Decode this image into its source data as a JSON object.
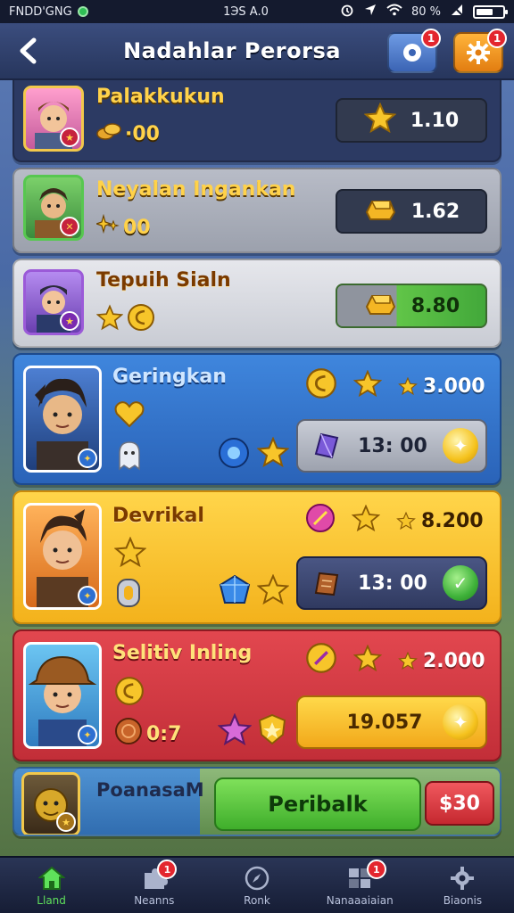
{
  "status_bar": {
    "carrier": "FNDD'GNG",
    "time": "1ЭS A.0",
    "battery_pct": "80 %"
  },
  "header": {
    "title": "Nadahlar Perorsa",
    "left_badge": "1",
    "right_badge": "1"
  },
  "rows": [
    {
      "name": "Palakkukun",
      "sub_value": "·00",
      "price": "1.10"
    },
    {
      "name": "Neyalan Ingankan",
      "sub_value": "00",
      "price": "1.62"
    },
    {
      "name": "Tepuih Sialn",
      "price": "8.80"
    },
    {
      "name": "Geringkan",
      "stat": "3.000",
      "timer": "13: 00"
    },
    {
      "name": "Devrikal",
      "stat": "8.200",
      "timer": "13: 00"
    },
    {
      "name": "Selitiv Inling",
      "stat": "2.000",
      "timer": "19.057",
      "level": "0:7"
    },
    {
      "name": "PoanasaM",
      "button": "Peribalk",
      "price": "$30"
    }
  ],
  "bottom_nav": [
    {
      "label": "Lland",
      "icon": "home-icon",
      "active": true,
      "badge": ""
    },
    {
      "label": "Neanns",
      "icon": "puzzle-icon",
      "active": false,
      "badge": "1"
    },
    {
      "label": "Ronk",
      "icon": "compass-icon",
      "active": false,
      "badge": ""
    },
    {
      "label": "Nanaaaiaian",
      "icon": "grid-icon",
      "active": false,
      "badge": "1"
    },
    {
      "label": "Biaonis",
      "icon": "gear-icon",
      "active": false,
      "badge": ""
    }
  ],
  "colors": {
    "accent_green": "#5fe15b",
    "badge_red": "#e3262e",
    "gold": "#ffd24a"
  }
}
